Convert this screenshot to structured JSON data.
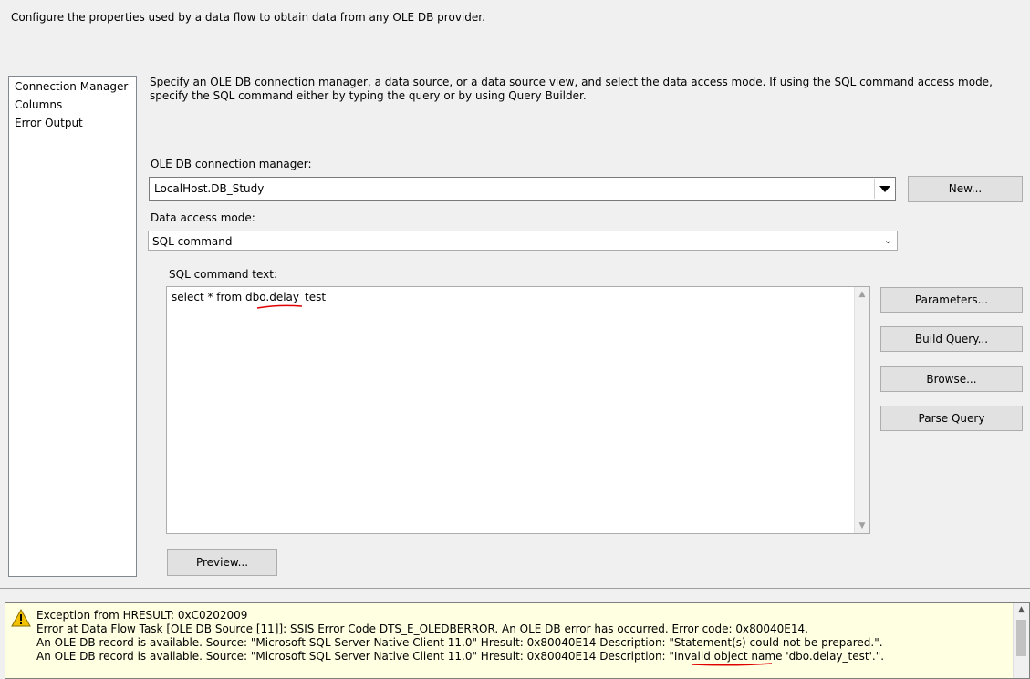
{
  "header": {
    "text": "Configure the properties used by a data flow to obtain data from any OLE DB provider."
  },
  "nav": {
    "items": [
      {
        "label": "Connection Manager"
      },
      {
        "label": "Columns"
      },
      {
        "label": "Error Output"
      }
    ]
  },
  "description": "Specify an OLE DB connection manager, a data source, or a data source view, and select the data access mode. If using the SQL command access mode, specify the SQL command either by typing the query or by using Query Builder.",
  "connection": {
    "label": "OLE DB connection manager:",
    "value": "LocalHost.DB_Study",
    "new_button": "New..."
  },
  "access_mode": {
    "label": "Data access mode:",
    "value": "SQL command"
  },
  "sql": {
    "label": "SQL command text:",
    "text_prefix": "select * from dbo.",
    "text_table": "delay_test"
  },
  "buttons": {
    "parameters": "Parameters...",
    "build_query": "Build Query...",
    "browse": "Browse...",
    "parse_query": "Parse Query",
    "preview": "Preview..."
  },
  "error": {
    "icon": "warning-icon",
    "lines": [
      "Exception from HRESULT: 0xC0202009",
      "Error at Data Flow Task [OLE DB Source [11]]: SSIS Error Code DTS_E_OLEDBERROR.  An OLE DB error has occurred. Error code: 0x80040E14.",
      "An OLE DB record is available.  Source: \"Microsoft SQL Server Native Client 11.0\"  Hresult: 0x80040E14  Description: \"Statement(s) could not be prepared.\".",
      "An OLE DB record is available.  Source: \"Microsoft SQL Server Native Client 11.0\"  Hresult: 0x80040E14  Description: \"Invalid object name 'dbo.delay_test'.\"."
    ]
  },
  "colors": {
    "error_bg": "#ffffe1",
    "annotation_red": "#e00000",
    "nav_selected_border": "#bcbcbc"
  }
}
